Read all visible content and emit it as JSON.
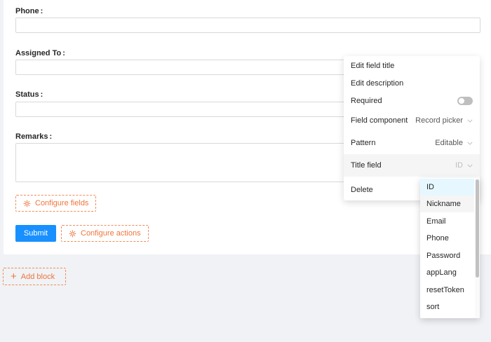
{
  "form": {
    "fields": [
      {
        "label": "Phone",
        "colon": ":"
      },
      {
        "label": "Assigned To",
        "colon": ":"
      },
      {
        "label": "Status",
        "colon": ":"
      },
      {
        "label": "Remarks",
        "colon": ":"
      }
    ],
    "configure_fields_label": "Configure fields",
    "submit_label": "Submit",
    "configure_actions_label": "Configure actions",
    "add_block_label": "Add block"
  },
  "menu": {
    "edit_title": "Edit field title",
    "edit_description": "Edit description",
    "required": {
      "label": "Required",
      "enabled": false
    },
    "field_component": {
      "label": "Field component",
      "value": "Record picker"
    },
    "pattern": {
      "label": "Pattern",
      "value": "Editable"
    },
    "title_field": {
      "label": "Title field",
      "value": "ID"
    },
    "delete": "Delete"
  },
  "dropdown": {
    "options": [
      "ID",
      "Nickname",
      "Email",
      "Phone",
      "Password",
      "appLang",
      "resetToken",
      "sort"
    ],
    "selected": "ID",
    "hovered": "Nickname"
  },
  "colors": {
    "primary": "#1890ff",
    "accent_orange": "#f0743a",
    "selected_bg": "#e6f7ff"
  }
}
